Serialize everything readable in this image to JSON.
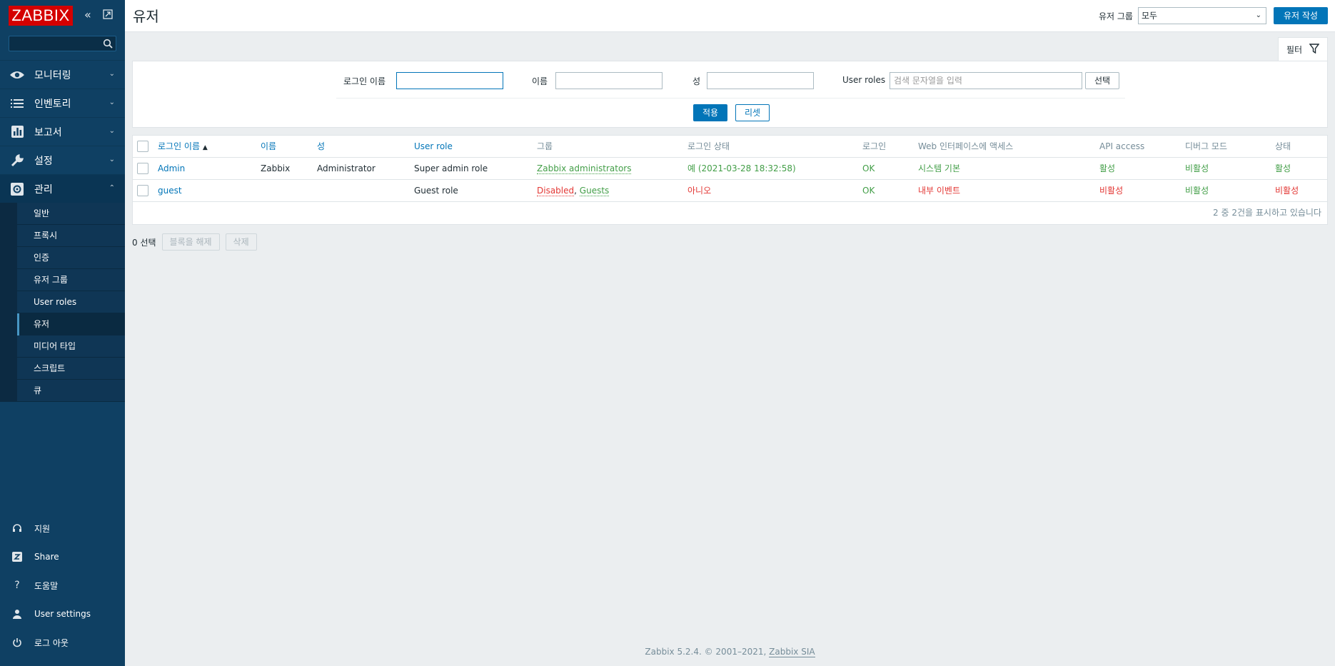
{
  "brand": {
    "logo": "ZABBIX"
  },
  "sidebar": {
    "menu": [
      {
        "label": "모니터링",
        "icon": "eye-icon"
      },
      {
        "label": "인벤토리",
        "icon": "list-icon"
      },
      {
        "label": "보고서",
        "icon": "chart-icon"
      },
      {
        "label": "설정",
        "icon": "wrench-icon"
      },
      {
        "label": "관리",
        "icon": "gear-icon"
      }
    ],
    "admin_sub": [
      "일반",
      "프록시",
      "인증",
      "유저 그룹",
      "User roles",
      "유저",
      "미디어 타입",
      "스크립트",
      "큐"
    ],
    "bottom": [
      {
        "label": "지원",
        "icon": "headset-icon"
      },
      {
        "label": "Share",
        "icon": "share-icon"
      },
      {
        "label": "도움말",
        "icon": "help-icon"
      },
      {
        "label": "User settings",
        "icon": "user-icon"
      },
      {
        "label": "로그 아웃",
        "icon": "power-icon"
      }
    ]
  },
  "header": {
    "title": "유저",
    "group_label": "유저 그룹",
    "group_value": "모두",
    "create_button": "유저 작성"
  },
  "filter": {
    "tab_label": "필터",
    "login_label": "로그인 이름",
    "name_label": "이름",
    "surname_label": "성",
    "roles_label": "User roles",
    "roles_placeholder": "검색 문자열을 입력",
    "select_button": "선택",
    "apply_button": "적용",
    "reset_button": "리셋"
  },
  "table": {
    "headers": [
      "로그인 이름",
      "이름",
      "성",
      "User role",
      "그룹",
      "로그인 상태",
      "로그인",
      "Web 인터페이스에 액세스",
      "API access",
      "디버그 모드",
      "상태"
    ],
    "sort_indicator": "▲",
    "rows": [
      {
        "login": "OK",
        "name": "Zabbix",
        "surname": "Administrator",
        "role": "Super admin role",
        "groups": [
          "Zabbix administrators"
        ],
        "login_status": "예 (2021-03-28 18:32:58)",
        "gui_access": "시스템 기본",
        "api_access": "활성",
        "debug": "비활성",
        "status": "활성"
      },
      {
        "login": "OK",
        "name": "",
        "surname": "",
        "role": "Guest role",
        "groups": [
          "Disabled",
          "Guests"
        ],
        "login_status": "아니오",
        "gui_access": "내부 이벤트",
        "api_access": "비활성",
        "debug": "비활성",
        "status": "비활성"
      }
    ],
    "row_labels": {
      "r1": {
        "login": "Admin",
        "name": "Zabbix",
        "surname": "Administrator",
        "role": "Super admin role",
        "group1": "Zabbix administrators",
        "login_status": "예 (2021-03-28 18:32:58)",
        "login_ok": "OK",
        "gui": "시스템 기본",
        "api": "활성",
        "debug": "비활성",
        "status": "활성"
      },
      "r2": {
        "login": "guest",
        "role": "Guest role",
        "group1": "Disabled",
        "group_sep": ",",
        "group2": "Guests",
        "login_status": "아니오",
        "login_ok": "OK",
        "gui": "내부 이벤트",
        "api": "비활성",
        "debug": "비활성",
        "status": "비활성"
      }
    },
    "summary": "2 중 2건을 표시하고 있습니다"
  },
  "actions": {
    "selected": "0 선택",
    "unblock_button": "블록을 해제",
    "delete_button": "삭제"
  },
  "footer": {
    "text": "Zabbix 5.2.4. © 2001–2021,",
    "link": "Zabbix SIA"
  },
  "colors": {
    "sidebar": "#0f4063",
    "accent": "#0275b8",
    "logo": "#d40000",
    "ok_green": "#429e47",
    "alert_red": "#e33734"
  }
}
